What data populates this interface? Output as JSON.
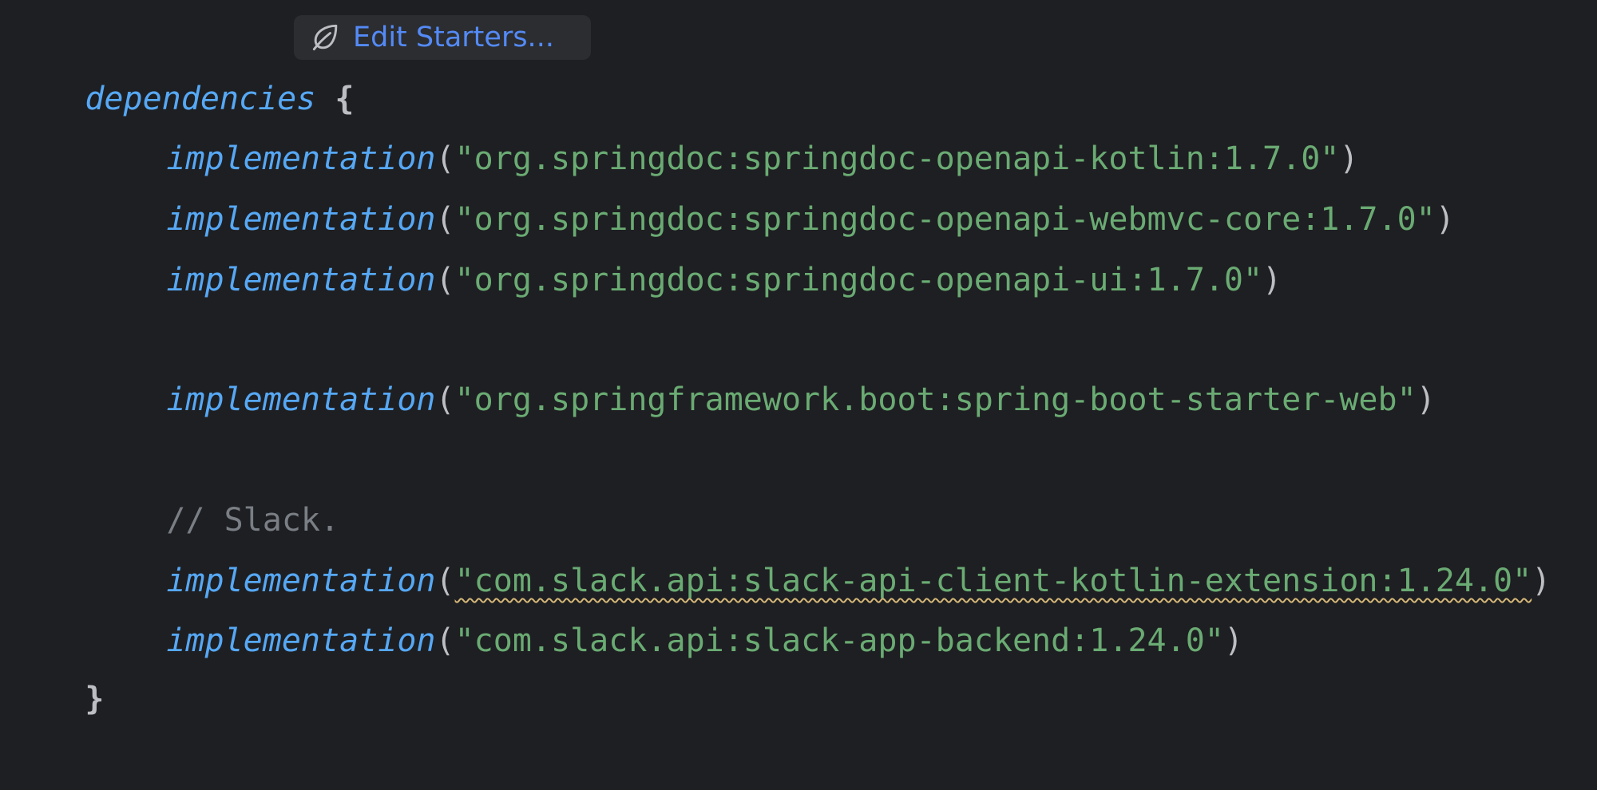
{
  "editor": {
    "block_keyword": "dependencies",
    "open_brace": "{",
    "close_brace": "}",
    "inlay_hint": {
      "label": "Edit Starters...",
      "icon": "spring-leaf-icon"
    },
    "call_name": "implementation",
    "paren_open": "(",
    "paren_close": ")",
    "dependencies": [
      "\"org.springdoc:springdoc-openapi-kotlin:1.7.0\"",
      "\"org.springdoc:springdoc-openapi-webmvc-core:1.7.0\"",
      "\"org.springdoc:springdoc-openapi-ui:1.7.0\"",
      "\"org.springframework.boot:spring-boot-starter-web\"",
      "\"com.slack.api:slack-api-client-kotlin-extension:1.24.0\"",
      "\"com.slack.api:slack-app-backend:1.24.0\""
    ],
    "comment": "// Slack."
  },
  "colors": {
    "background": "#1e1f22",
    "keyword": "#56a8f5",
    "string": "#6aab73",
    "comment": "#7a7e85",
    "text": "#bcbec4",
    "inlay_background": "#2b2d30",
    "inlay_text": "#548af7",
    "warning_underline": "#d5b778"
  }
}
